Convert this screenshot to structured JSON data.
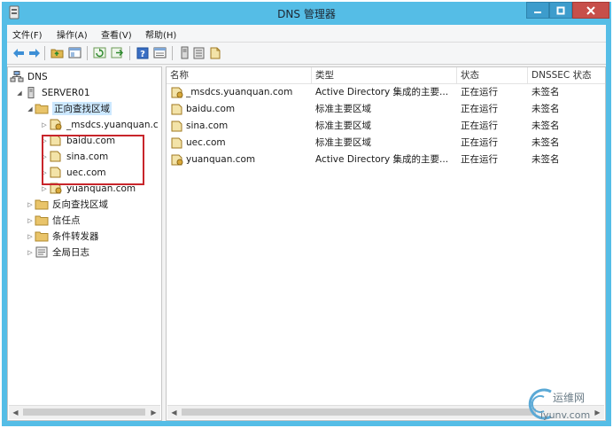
{
  "window": {
    "title": "DNS 管理器"
  },
  "menu": [
    "文件(F)",
    "操作(A)",
    "查看(V)",
    "帮助(H)"
  ],
  "tree": [
    {
      "label": "DNS",
      "level": 0
    },
    {
      "label": "SERVER01",
      "level": 1
    },
    {
      "label": "正向查找区域",
      "level": 2,
      "selected": true
    },
    {
      "label": "_msdcs.yuanquan.c",
      "level": 3
    },
    {
      "label": "baidu.com",
      "level": 3
    },
    {
      "label": "sina.com",
      "level": 3
    },
    {
      "label": "uec.com",
      "level": 3
    },
    {
      "label": "yuanquan.com",
      "level": 3
    },
    {
      "label": "反向查找区域",
      "level": 2
    },
    {
      "label": "信任点",
      "level": 2
    },
    {
      "label": "条件转发器",
      "level": 2
    },
    {
      "label": "全局日志",
      "level": 2
    }
  ],
  "list": {
    "columns": [
      "名称",
      "类型",
      "状态",
      "DNSSEC 状态"
    ],
    "rows": [
      [
        "_msdcs.yuanquan.com",
        "Active Directory 集成的主要...",
        "正在运行",
        "未签名"
      ],
      [
        "baidu.com",
        "标准主要区域",
        "正在运行",
        "未签名"
      ],
      [
        "sina.com",
        "标准主要区域",
        "正在运行",
        "未签名"
      ],
      [
        "uec.com",
        "标准主要区域",
        "正在运行",
        "未签名"
      ],
      [
        "yuanquan.com",
        "Active Directory 集成的主要...",
        "正在运行",
        "未签名"
      ]
    ]
  },
  "watermark": {
    "line1": "运维网",
    "line2": "iyunv.com"
  },
  "colors": {
    "titlebar": "#55bde6",
    "close": "#c74f4a",
    "highlight": "#c8252b",
    "folder": "#e9c46a",
    "selected": "#cce8ff"
  }
}
